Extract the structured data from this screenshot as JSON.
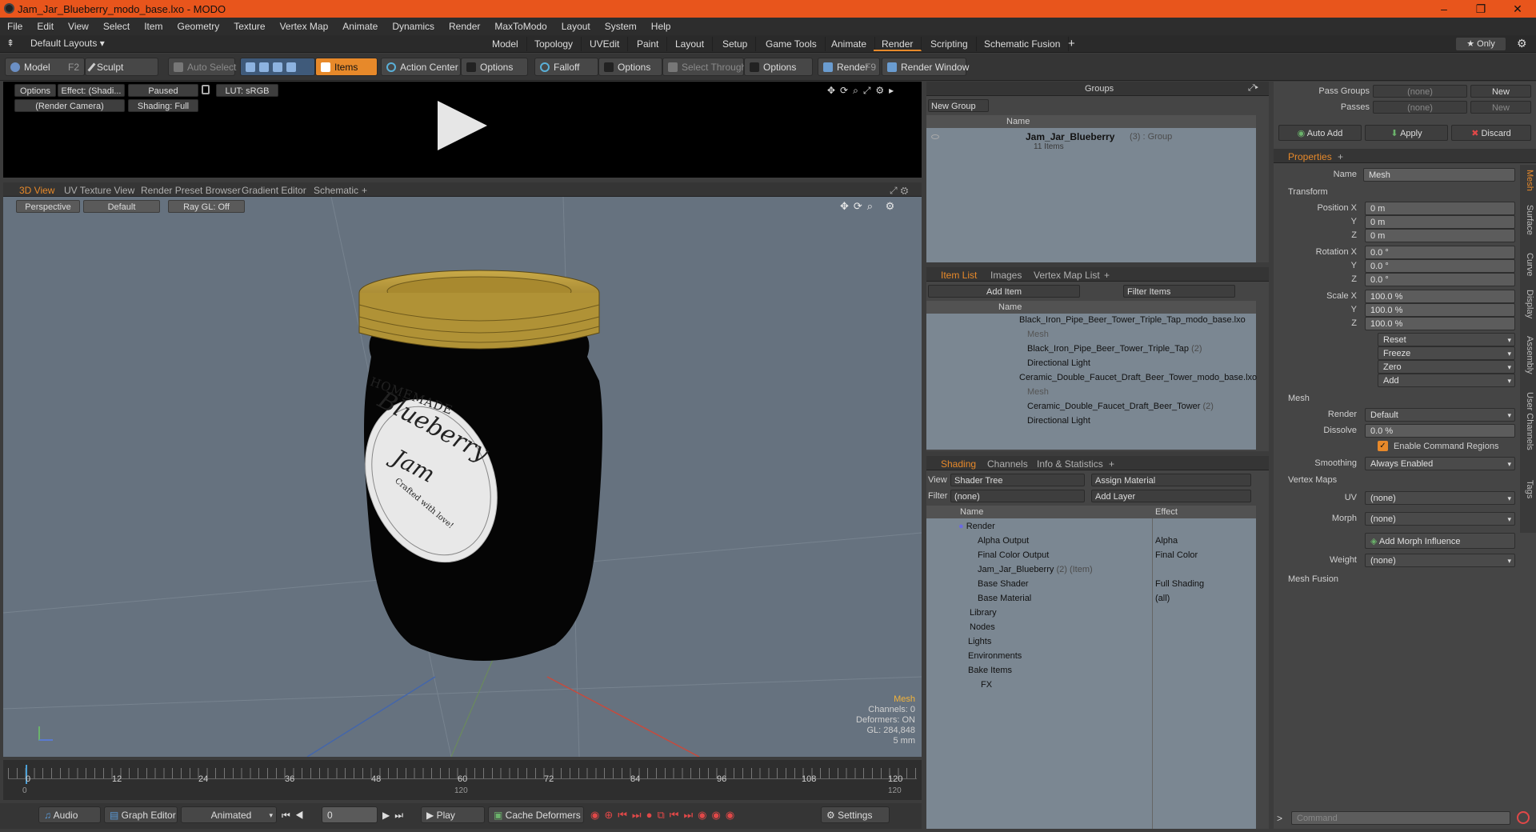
{
  "window": {
    "title": "Jam_Jar_Blueberry_modo_base.lxo - MODO",
    "minimize": "–",
    "restore": "❐",
    "close": "✕"
  },
  "menu": [
    "File",
    "Edit",
    "View",
    "Select",
    "Item",
    "Geometry",
    "Texture",
    "Vertex Map",
    "Animate",
    "Dynamics",
    "Render",
    "MaxToModo",
    "Layout",
    "System",
    "Help"
  ],
  "layout_bar": {
    "default_layouts": "Default Layouts ▾",
    "tabs": [
      "Model",
      "Topology",
      "UVEdit",
      "Paint",
      "Layout",
      "Setup",
      "Game Tools",
      "Animate",
      "Render",
      "Scripting",
      "Schematic Fusion"
    ],
    "active_tab": "Render",
    "add": "+",
    "only": "★  Only",
    "gear": "⚙"
  },
  "toolbar": {
    "model": "Model",
    "model_key": "F2",
    "sculpt": "Sculpt",
    "auto_select": "Auto Select",
    "items": "Items",
    "action_center": "Action Center",
    "options1": "Options",
    "falloff": "Falloff",
    "options2": "Options",
    "select_through": "Select Through",
    "options3": "Options",
    "render": "Render",
    "render_key": "F9",
    "render_window": "Render Window"
  },
  "preview": {
    "options": "Options",
    "effect": "Effect: (Shadi...",
    "paused": "Paused",
    "lut": "LUT: sRGB",
    "camera": "(Render Camera)",
    "shading": "Shading: Full"
  },
  "viewport_tabs": [
    "3D View",
    "UV Texture View",
    "Render Preset Browser",
    "Gradient Editor",
    "Schematic",
    "+"
  ],
  "viewport": {
    "perspective": "Perspective",
    "default": "Default",
    "raygl": "Ray GL: Off",
    "label_text": [
      "HOMEMADE",
      "Blueberry",
      "Jam",
      "Crafted with love!"
    ],
    "info": {
      "title": "Mesh",
      "channels": "Channels: 0",
      "deformers": "Deformers: ON",
      "gl": "GL: 284,848",
      "scale": "5 mm"
    }
  },
  "timeline": {
    "ticks": [
      "0",
      "12",
      "24",
      "36",
      "48",
      "60",
      "72",
      "84",
      "96",
      "108",
      "120"
    ],
    "sub_start": "0",
    "sub_mid": "120",
    "sub_end": "120"
  },
  "bottom_bar": {
    "audio": "Audio",
    "graph_editor": "Graph Editor",
    "animated": "Animated",
    "frame": "0",
    "play": "Play",
    "cache_deformers": "Cache Deformers",
    "settings": "Settings"
  },
  "groups": {
    "title": "Groups",
    "new_group": "New Group",
    "col_name": "Name",
    "item_name": "Jam_Jar_Blueberry",
    "item_suffix": "(3) : Group",
    "item_count": "11 Items"
  },
  "item_list": {
    "tabs": [
      "Item List",
      "Images",
      "Vertex Map List",
      "+"
    ],
    "add_item": "Add Item",
    "filter_items": "Filter Items",
    "col_name": "Name",
    "rows": [
      {
        "text": "Black_Iron_Pipe_Beer_Tower_Triple_Tap_modo_base.lxo",
        "suffix": "",
        "dim": false
      },
      {
        "text": "Mesh",
        "suffix": "",
        "dim": true
      },
      {
        "text": "Black_Iron_Pipe_Beer_Tower_Triple_Tap",
        "suffix": "(2)",
        "dim": false
      },
      {
        "text": "Directional Light",
        "suffix": "",
        "dim": false
      },
      {
        "text": "Ceramic_Double_Faucet_Draft_Beer_Tower_modo_base.lxo",
        "suffix": "",
        "dim": false
      },
      {
        "text": "Mesh",
        "suffix": "",
        "dim": true
      },
      {
        "text": "Ceramic_Double_Faucet_Draft_Beer_Tower",
        "suffix": "(2)",
        "dim": false
      },
      {
        "text": "Directional Light",
        "suffix": "",
        "dim": false
      }
    ]
  },
  "shading": {
    "tabs": [
      "Shading",
      "Channels",
      "Info & Statistics",
      "+"
    ],
    "view_label": "View",
    "view_value": "Shader Tree",
    "assign_material": "Assign Material",
    "filter_label": "Filter",
    "filter_value": "(none)",
    "add_layer": "Add Layer",
    "col_name": "Name",
    "col_effect": "Effect",
    "rows": [
      {
        "name": "Render",
        "effect": ""
      },
      {
        "name": "Alpha Output",
        "effect": "Alpha"
      },
      {
        "name": "Final Color Output",
        "effect": "Final Color"
      },
      {
        "name": "Jam_Jar_Blueberry",
        "effect": ""
      },
      {
        "name": "Base Shader",
        "effect": "Full Shading"
      },
      {
        "name": "Base Material",
        "effect": "(all)"
      },
      {
        "name": "Library",
        "effect": ""
      },
      {
        "name": "Nodes",
        "effect": ""
      },
      {
        "name": "Lights",
        "effect": ""
      },
      {
        "name": "Environments",
        "effect": ""
      },
      {
        "name": "Bake Items",
        "effect": ""
      },
      {
        "name": "FX",
        "effect": ""
      }
    ],
    "jam_suffix": "(2) (Item)"
  },
  "passes": {
    "pass_groups": "Pass Groups",
    "pass_groups_val": "(none)",
    "new1": "New",
    "passes": "Passes",
    "passes_val": "(none)",
    "new2": "New",
    "auto_add": "Auto Add",
    "apply": "Apply",
    "discard": "Discard"
  },
  "properties": {
    "tab": "Properties",
    "add": "+",
    "name_label": "Name",
    "name_value": "Mesh",
    "transform": "Transform",
    "position_label": "Position X",
    "pos": [
      "0 m",
      "0 m",
      "0 m"
    ],
    "rotation_label": "Rotation X",
    "rot": [
      "0.0 °",
      "0.0 °",
      "0.0 °"
    ],
    "scale_label": "Scale X",
    "scl": [
      "100.0 %",
      "100.0 %",
      "100.0 %"
    ],
    "y": "Y",
    "z": "Z",
    "reset": "Reset",
    "freeze": "Freeze",
    "zero": "Zero",
    "add_btn": "Add",
    "mesh": "Mesh",
    "render_label": "Render",
    "render_value": "Default",
    "dissolve_label": "Dissolve",
    "dissolve_value": "0.0 %",
    "enable_cmd": "Enable Command Regions",
    "smoothing_label": "Smoothing",
    "smoothing_value": "Always Enabled",
    "vertex_maps": "Vertex Maps",
    "uv_label": "UV",
    "uv_value": "(none)",
    "morph_label": "Morph",
    "morph_value": "(none)",
    "add_morph": "Add Morph Influence",
    "weight_label": "Weight",
    "weight_value": "(none)",
    "mesh_fusion": "Mesh Fusion",
    "side_tabs": [
      "Mesh",
      "Surface",
      "Curve",
      "Display",
      "Assembly",
      "User Channels",
      "Tags"
    ]
  },
  "command": {
    "placeholder": "Command",
    "prompt": ">"
  }
}
